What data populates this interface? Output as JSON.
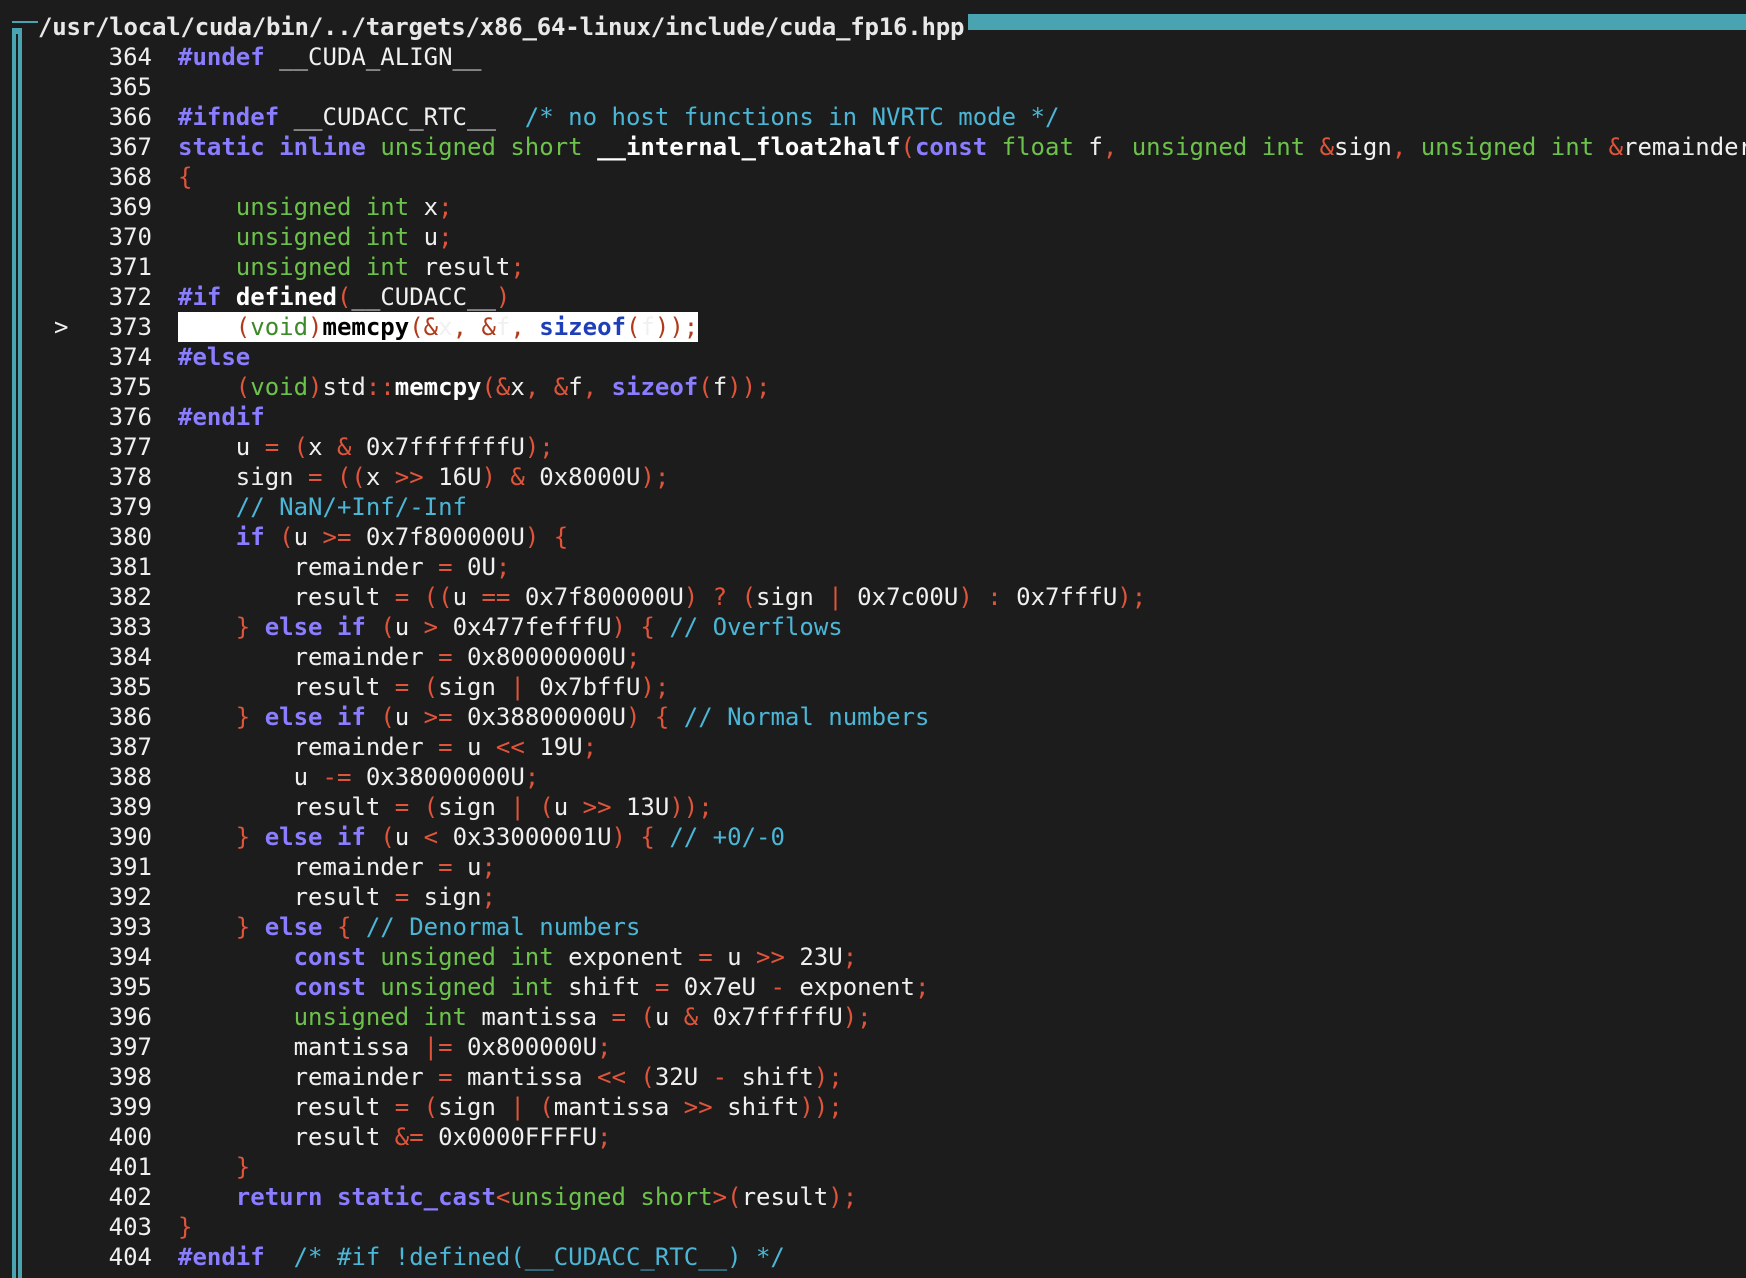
{
  "window": {
    "title": "/usr/local/cuda/bin/../targets/x86_64-linux/include/cuda_fp16.hpp"
  },
  "current_line": 373,
  "current_marker": ">",
  "lines": [
    {
      "n": "364",
      "indent": "",
      "toks": [
        [
          "p",
          "#undef"
        ],
        [
          "i",
          " __CUDA_ALIGN__"
        ]
      ]
    },
    {
      "n": "365",
      "indent": "",
      "toks": []
    },
    {
      "n": "366",
      "indent": "",
      "toks": [
        [
          "p",
          "#ifndef"
        ],
        [
          "i",
          " __CUDACC_RTC__  "
        ],
        [
          "c",
          "/* no host functions in NVRTC mode */"
        ]
      ]
    },
    {
      "n": "367",
      "indent": "",
      "toks": [
        [
          "k",
          "static"
        ],
        [
          "i",
          " "
        ],
        [
          "k",
          "inline"
        ],
        [
          "i",
          " "
        ],
        [
          "t",
          "unsigned short"
        ],
        [
          "i",
          " "
        ],
        [
          "fn",
          "__internal_float2half"
        ],
        [
          "o",
          "("
        ],
        [
          "k",
          "const"
        ],
        [
          "i",
          " "
        ],
        [
          "t",
          "float"
        ],
        [
          "i",
          " f"
        ],
        [
          "o",
          ","
        ],
        [
          "i",
          " "
        ],
        [
          "t",
          "unsigned int"
        ],
        [
          "i",
          " "
        ],
        [
          "o",
          "&"
        ],
        [
          "i",
          "sign"
        ],
        [
          "o",
          ","
        ],
        [
          "i",
          " "
        ],
        [
          "t",
          "unsigned int"
        ],
        [
          "i",
          " "
        ],
        [
          "o",
          "&"
        ],
        [
          "i",
          "remainder"
        ],
        [
          "o",
          ")"
        ]
      ]
    },
    {
      "n": "368",
      "indent": "",
      "toks": [
        [
          "o",
          "{"
        ]
      ]
    },
    {
      "n": "369",
      "indent": "    ",
      "toks": [
        [
          "t",
          "unsigned int"
        ],
        [
          "i",
          " x"
        ],
        [
          "o",
          ";"
        ]
      ]
    },
    {
      "n": "370",
      "indent": "    ",
      "toks": [
        [
          "t",
          "unsigned int"
        ],
        [
          "i",
          " u"
        ],
        [
          "o",
          ";"
        ]
      ]
    },
    {
      "n": "371",
      "indent": "    ",
      "toks": [
        [
          "t",
          "unsigned int"
        ],
        [
          "i",
          " result"
        ],
        [
          "o",
          ";"
        ]
      ]
    },
    {
      "n": "372",
      "indent": "",
      "toks": [
        [
          "p",
          "#if"
        ],
        [
          "i",
          " "
        ],
        [
          "fn",
          "defined"
        ],
        [
          "o",
          "("
        ],
        [
          "i",
          "__CUDACC__"
        ],
        [
          "o",
          ")"
        ]
      ]
    },
    {
      "n": "373",
      "indent": "    ",
      "toks": [
        [
          "o",
          "("
        ],
        [
          "t",
          "void"
        ],
        [
          "o",
          ")"
        ],
        [
          "fn",
          "memcpy"
        ],
        [
          "o",
          "(&"
        ],
        [
          "i",
          "x"
        ],
        [
          "o",
          ","
        ],
        [
          "i",
          " "
        ],
        [
          "o",
          "&"
        ],
        [
          "i",
          "f"
        ],
        [
          "o",
          ","
        ],
        [
          "i",
          " "
        ],
        [
          "k",
          "sizeof"
        ],
        [
          "o",
          "("
        ],
        [
          "i",
          "f"
        ],
        [
          "o",
          "));"
        ]
      ]
    },
    {
      "n": "374",
      "indent": "",
      "toks": [
        [
          "p",
          "#else"
        ]
      ]
    },
    {
      "n": "375",
      "indent": "    ",
      "toks": [
        [
          "o",
          "("
        ],
        [
          "t",
          "void"
        ],
        [
          "o",
          ")"
        ],
        [
          "i",
          "std"
        ],
        [
          "o",
          "::"
        ],
        [
          "fn",
          "memcpy"
        ],
        [
          "o",
          "(&"
        ],
        [
          "i",
          "x"
        ],
        [
          "o",
          ","
        ],
        [
          "i",
          " "
        ],
        [
          "o",
          "&"
        ],
        [
          "i",
          "f"
        ],
        [
          "o",
          ","
        ],
        [
          "i",
          " "
        ],
        [
          "k",
          "sizeof"
        ],
        [
          "o",
          "("
        ],
        [
          "i",
          "f"
        ],
        [
          "o",
          "));"
        ]
      ]
    },
    {
      "n": "376",
      "indent": "",
      "toks": [
        [
          "p",
          "#endif"
        ]
      ]
    },
    {
      "n": "377",
      "indent": "    ",
      "toks": [
        [
          "i",
          "u "
        ],
        [
          "o",
          "="
        ],
        [
          "i",
          " "
        ],
        [
          "o",
          "("
        ],
        [
          "i",
          "x "
        ],
        [
          "o",
          "&"
        ],
        [
          "i",
          " 0x7fffffffU"
        ],
        [
          "o",
          ");"
        ]
      ]
    },
    {
      "n": "378",
      "indent": "    ",
      "toks": [
        [
          "i",
          "sign "
        ],
        [
          "o",
          "="
        ],
        [
          "i",
          " "
        ],
        [
          "o",
          "(("
        ],
        [
          "i",
          "x "
        ],
        [
          "o",
          ">>"
        ],
        [
          "i",
          " 16U"
        ],
        [
          "o",
          ")"
        ],
        [
          "i",
          " "
        ],
        [
          "o",
          "&"
        ],
        [
          "i",
          " 0x8000U"
        ],
        [
          "o",
          ");"
        ]
      ]
    },
    {
      "n": "379",
      "indent": "    ",
      "toks": [
        [
          "c",
          "// NaN/+Inf/-Inf"
        ]
      ]
    },
    {
      "n": "380",
      "indent": "    ",
      "toks": [
        [
          "k",
          "if"
        ],
        [
          "i",
          " "
        ],
        [
          "o",
          "("
        ],
        [
          "i",
          "u "
        ],
        [
          "o",
          ">="
        ],
        [
          "i",
          " 0x7f800000U"
        ],
        [
          "o",
          ")"
        ],
        [
          "i",
          " "
        ],
        [
          "o",
          "{"
        ]
      ]
    },
    {
      "n": "381",
      "indent": "        ",
      "toks": [
        [
          "i",
          "remainder "
        ],
        [
          "o",
          "="
        ],
        [
          "i",
          " 0U"
        ],
        [
          "o",
          ";"
        ]
      ]
    },
    {
      "n": "382",
      "indent": "        ",
      "toks": [
        [
          "i",
          "result "
        ],
        [
          "o",
          "="
        ],
        [
          "i",
          " "
        ],
        [
          "o",
          "(("
        ],
        [
          "i",
          "u "
        ],
        [
          "o",
          "=="
        ],
        [
          "i",
          " 0x7f800000U"
        ],
        [
          "o",
          ")"
        ],
        [
          "i",
          " "
        ],
        [
          "o",
          "?"
        ],
        [
          "i",
          " "
        ],
        [
          "o",
          "("
        ],
        [
          "i",
          "sign "
        ],
        [
          "o",
          "|"
        ],
        [
          "i",
          " 0x7c00U"
        ],
        [
          "o",
          ")"
        ],
        [
          "i",
          " "
        ],
        [
          "o",
          ":"
        ],
        [
          "i",
          " 0x7fffU"
        ],
        [
          "o",
          ");"
        ]
      ]
    },
    {
      "n": "383",
      "indent": "    ",
      "toks": [
        [
          "o",
          "}"
        ],
        [
          "i",
          " "
        ],
        [
          "k",
          "else if"
        ],
        [
          "i",
          " "
        ],
        [
          "o",
          "("
        ],
        [
          "i",
          "u "
        ],
        [
          "o",
          ">"
        ],
        [
          "i",
          " 0x477fefffU"
        ],
        [
          "o",
          ")"
        ],
        [
          "i",
          " "
        ],
        [
          "o",
          "{"
        ],
        [
          "i",
          " "
        ],
        [
          "c",
          "// Overflows"
        ]
      ]
    },
    {
      "n": "384",
      "indent": "        ",
      "toks": [
        [
          "i",
          "remainder "
        ],
        [
          "o",
          "="
        ],
        [
          "i",
          " 0x80000000U"
        ],
        [
          "o",
          ";"
        ]
      ]
    },
    {
      "n": "385",
      "indent": "        ",
      "toks": [
        [
          "i",
          "result "
        ],
        [
          "o",
          "="
        ],
        [
          "i",
          " "
        ],
        [
          "o",
          "("
        ],
        [
          "i",
          "sign "
        ],
        [
          "o",
          "|"
        ],
        [
          "i",
          " 0x7bffU"
        ],
        [
          "o",
          ");"
        ]
      ]
    },
    {
      "n": "386",
      "indent": "    ",
      "toks": [
        [
          "o",
          "}"
        ],
        [
          "i",
          " "
        ],
        [
          "k",
          "else if"
        ],
        [
          "i",
          " "
        ],
        [
          "o",
          "("
        ],
        [
          "i",
          "u "
        ],
        [
          "o",
          ">="
        ],
        [
          "i",
          " 0x38800000U"
        ],
        [
          "o",
          ")"
        ],
        [
          "i",
          " "
        ],
        [
          "o",
          "{"
        ],
        [
          "i",
          " "
        ],
        [
          "c",
          "// Normal numbers"
        ]
      ]
    },
    {
      "n": "387",
      "indent": "        ",
      "toks": [
        [
          "i",
          "remainder "
        ],
        [
          "o",
          "="
        ],
        [
          "i",
          " u "
        ],
        [
          "o",
          "<<"
        ],
        [
          "i",
          " 19U"
        ],
        [
          "o",
          ";"
        ]
      ]
    },
    {
      "n": "388",
      "indent": "        ",
      "toks": [
        [
          "i",
          "u "
        ],
        [
          "o",
          "-="
        ],
        [
          "i",
          " 0x38000000U"
        ],
        [
          "o",
          ";"
        ]
      ]
    },
    {
      "n": "389",
      "indent": "        ",
      "toks": [
        [
          "i",
          "result "
        ],
        [
          "o",
          "="
        ],
        [
          "i",
          " "
        ],
        [
          "o",
          "("
        ],
        [
          "i",
          "sign "
        ],
        [
          "o",
          "|"
        ],
        [
          "i",
          " "
        ],
        [
          "o",
          "("
        ],
        [
          "i",
          "u "
        ],
        [
          "o",
          ">>"
        ],
        [
          "i",
          " 13U"
        ],
        [
          "o",
          "));"
        ]
      ]
    },
    {
      "n": "390",
      "indent": "    ",
      "toks": [
        [
          "o",
          "}"
        ],
        [
          "i",
          " "
        ],
        [
          "k",
          "else if"
        ],
        [
          "i",
          " "
        ],
        [
          "o",
          "("
        ],
        [
          "i",
          "u "
        ],
        [
          "o",
          "<"
        ],
        [
          "i",
          " 0x33000001U"
        ],
        [
          "o",
          ")"
        ],
        [
          "i",
          " "
        ],
        [
          "o",
          "{"
        ],
        [
          "i",
          " "
        ],
        [
          "c",
          "// +0/-0"
        ]
      ]
    },
    {
      "n": "391",
      "indent": "        ",
      "toks": [
        [
          "i",
          "remainder "
        ],
        [
          "o",
          "="
        ],
        [
          "i",
          " u"
        ],
        [
          "o",
          ";"
        ]
      ]
    },
    {
      "n": "392",
      "indent": "        ",
      "toks": [
        [
          "i",
          "result "
        ],
        [
          "o",
          "="
        ],
        [
          "i",
          " sign"
        ],
        [
          "o",
          ";"
        ]
      ]
    },
    {
      "n": "393",
      "indent": "    ",
      "toks": [
        [
          "o",
          "}"
        ],
        [
          "i",
          " "
        ],
        [
          "k",
          "else"
        ],
        [
          "i",
          " "
        ],
        [
          "o",
          "{"
        ],
        [
          "i",
          " "
        ],
        [
          "c",
          "// Denormal numbers"
        ]
      ]
    },
    {
      "n": "394",
      "indent": "        ",
      "toks": [
        [
          "k",
          "const"
        ],
        [
          "i",
          " "
        ],
        [
          "t",
          "unsigned int"
        ],
        [
          "i",
          " exponent "
        ],
        [
          "o",
          "="
        ],
        [
          "i",
          " u "
        ],
        [
          "o",
          ">>"
        ],
        [
          "i",
          " 23U"
        ],
        [
          "o",
          ";"
        ]
      ]
    },
    {
      "n": "395",
      "indent": "        ",
      "toks": [
        [
          "k",
          "const"
        ],
        [
          "i",
          " "
        ],
        [
          "t",
          "unsigned int"
        ],
        [
          "i",
          " shift "
        ],
        [
          "o",
          "="
        ],
        [
          "i",
          " 0x7eU "
        ],
        [
          "o",
          "-"
        ],
        [
          "i",
          " exponent"
        ],
        [
          "o",
          ";"
        ]
      ]
    },
    {
      "n": "396",
      "indent": "        ",
      "toks": [
        [
          "t",
          "unsigned int"
        ],
        [
          "i",
          " mantissa "
        ],
        [
          "o",
          "="
        ],
        [
          "i",
          " "
        ],
        [
          "o",
          "("
        ],
        [
          "i",
          "u "
        ],
        [
          "o",
          "&"
        ],
        [
          "i",
          " 0x7fffffU"
        ],
        [
          "o",
          ");"
        ]
      ]
    },
    {
      "n": "397",
      "indent": "        ",
      "toks": [
        [
          "i",
          "mantissa "
        ],
        [
          "o",
          "|="
        ],
        [
          "i",
          " 0x800000U"
        ],
        [
          "o",
          ";"
        ]
      ]
    },
    {
      "n": "398",
      "indent": "        ",
      "toks": [
        [
          "i",
          "remainder "
        ],
        [
          "o",
          "="
        ],
        [
          "i",
          " mantissa "
        ],
        [
          "o",
          "<<"
        ],
        [
          "i",
          " "
        ],
        [
          "o",
          "("
        ],
        [
          "i",
          "32U "
        ],
        [
          "o",
          "-"
        ],
        [
          "i",
          " shift"
        ],
        [
          "o",
          ");"
        ]
      ]
    },
    {
      "n": "399",
      "indent": "        ",
      "toks": [
        [
          "i",
          "result "
        ],
        [
          "o",
          "="
        ],
        [
          "i",
          " "
        ],
        [
          "o",
          "("
        ],
        [
          "i",
          "sign "
        ],
        [
          "o",
          "|"
        ],
        [
          "i",
          " "
        ],
        [
          "o",
          "("
        ],
        [
          "i",
          "mantissa "
        ],
        [
          "o",
          ">>"
        ],
        [
          "i",
          " shift"
        ],
        [
          "o",
          "));"
        ]
      ]
    },
    {
      "n": "400",
      "indent": "        ",
      "toks": [
        [
          "i",
          "result "
        ],
        [
          "o",
          "&="
        ],
        [
          "i",
          " 0x0000FFFFU"
        ],
        [
          "o",
          ";"
        ]
      ]
    },
    {
      "n": "401",
      "indent": "    ",
      "toks": [
        [
          "o",
          "}"
        ]
      ]
    },
    {
      "n": "402",
      "indent": "    ",
      "toks": [
        [
          "k",
          "return"
        ],
        [
          "i",
          " "
        ],
        [
          "k",
          "static_cast"
        ],
        [
          "o",
          "<"
        ],
        [
          "t",
          "unsigned short"
        ],
        [
          "o",
          ">("
        ],
        [
          "i",
          "result"
        ],
        [
          "o",
          ");"
        ]
      ]
    },
    {
      "n": "403",
      "indent": "",
      "toks": [
        [
          "o",
          "}"
        ]
      ]
    },
    {
      "n": "404",
      "indent": "",
      "toks": [
        [
          "p",
          "#endif"
        ],
        [
          "i",
          "  "
        ],
        [
          "c",
          "/* #if !defined(__CUDACC_RTC__) */"
        ]
      ]
    }
  ]
}
